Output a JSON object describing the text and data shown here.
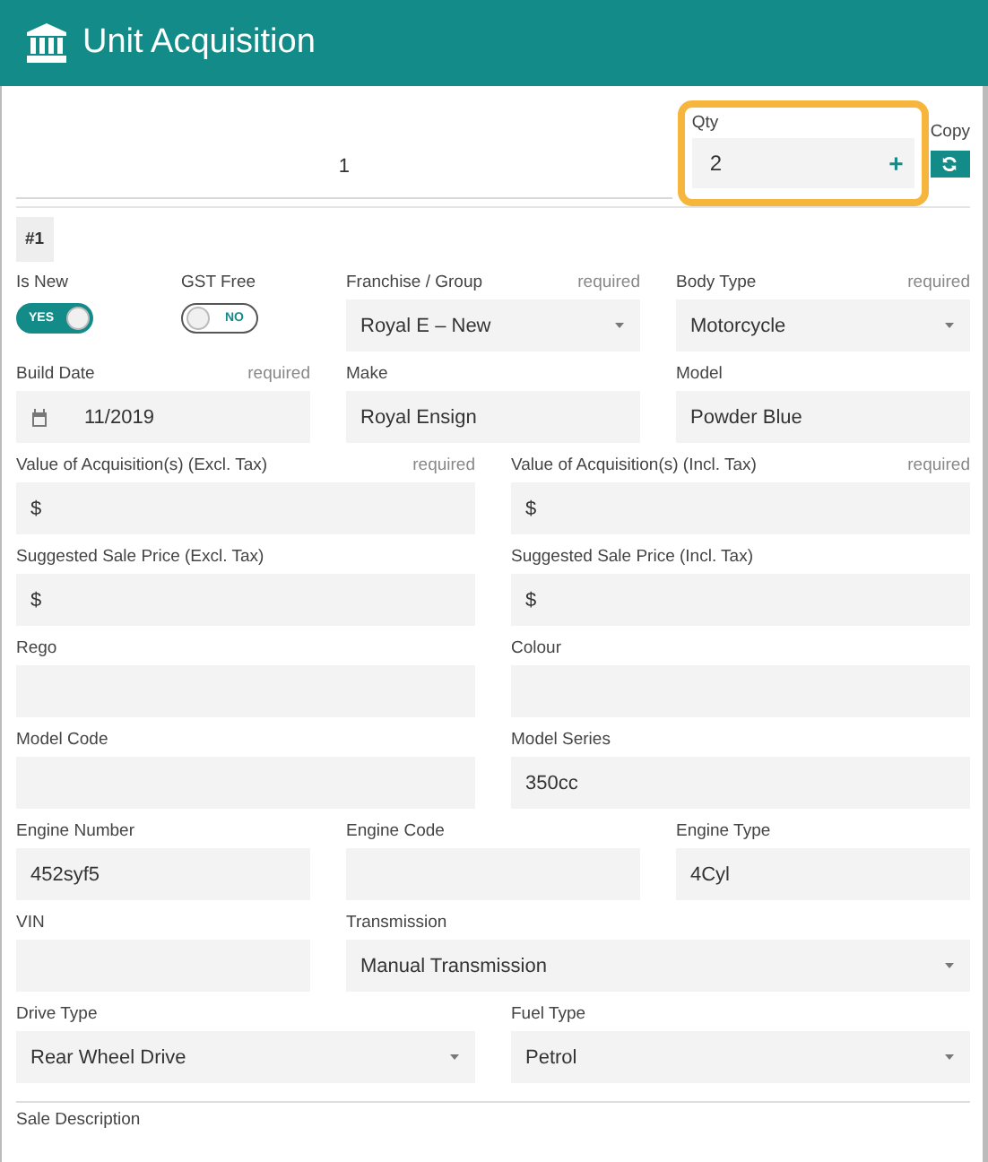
{
  "window": {
    "title": "Unit Acquisition"
  },
  "unit_tab": {
    "label": "1"
  },
  "qty": {
    "label": "Qty",
    "value": "2",
    "increment": "+",
    "highlighted": true
  },
  "copy": {
    "label": "Copy"
  },
  "unit_badge": "#1",
  "rows": [
    {
      "fields": [
        {
          "kind": "toggle",
          "label": "Is New",
          "on": true,
          "text": "YES"
        },
        {
          "kind": "toggle",
          "label": "GST Free",
          "on": false,
          "text": "NO"
        },
        {
          "kind": "select",
          "label": "Franchise / Group",
          "note": "required",
          "value": "Royal E – New"
        },
        {
          "kind": "select",
          "label": "Body Type",
          "note": "required",
          "value": "Motorcycle"
        }
      ]
    },
    {
      "fields": [
        {
          "kind": "date",
          "label": "Build Date",
          "note": "required",
          "value": "11/2019"
        },
        {
          "kind": "text",
          "label": "Make",
          "value": "Royal Ensign"
        },
        {
          "kind": "text",
          "label": "Model",
          "value": "Powder Blue"
        }
      ]
    },
    {
      "fields": [
        {
          "kind": "currency",
          "label": "Value of Acquisition(s) (Excl. Tax)",
          "note": "required",
          "symbol": "$"
        },
        {
          "kind": "currency",
          "label": "Value of Acquisition(s) (Incl. Tax)",
          "note": "required",
          "symbol": "$"
        }
      ]
    },
    {
      "fields": [
        {
          "kind": "currency",
          "label": "Suggested Sale Price (Excl. Tax)",
          "symbol": "$"
        },
        {
          "kind": "currency",
          "label": "Suggested Sale Price (Incl. Tax)",
          "symbol": "$"
        }
      ]
    },
    {
      "fields": [
        {
          "kind": "text",
          "label": "Rego"
        },
        {
          "kind": "text",
          "label": "Colour"
        }
      ]
    },
    {
      "fields": [
        {
          "kind": "text",
          "label": "Model Code"
        },
        {
          "kind": "text",
          "label": "Model Series",
          "value": "350cc"
        }
      ]
    },
    {
      "fields": [
        {
          "kind": "text",
          "label": "Engine Number",
          "value": "452syf5"
        },
        {
          "kind": "text",
          "label": "Engine Code"
        },
        {
          "kind": "text",
          "label": "Engine Type",
          "value": "4Cyl"
        }
      ]
    },
    {
      "fields": [
        {
          "kind": "text",
          "label": "VIN"
        },
        {
          "kind": "select",
          "label": "Transmission",
          "wide": true,
          "value": "Manual Transmission"
        }
      ]
    },
    {
      "fields": [
        {
          "kind": "select",
          "label": "Drive Type",
          "value": "Rear Wheel Drive"
        },
        {
          "kind": "select",
          "label": "Fuel Type",
          "value": "Petrol"
        }
      ]
    }
  ],
  "next_section": {
    "label": "Sale Description"
  }
}
